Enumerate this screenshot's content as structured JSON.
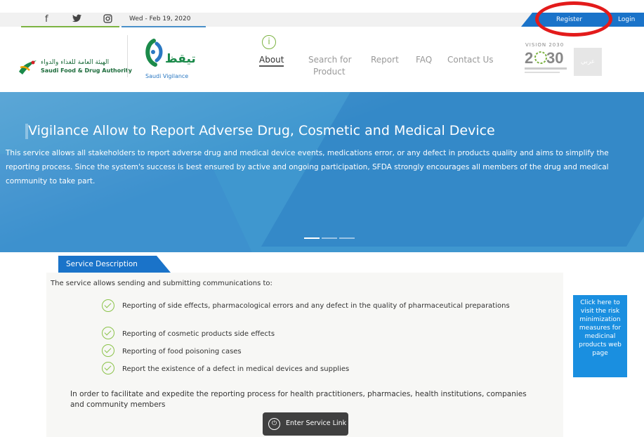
{
  "topbar": {
    "date": "Wed - Feb 19, 2020",
    "register_label": "Register",
    "login_label": "Login"
  },
  "header": {
    "sfda_arabic": "الهيئة العامة للغذاء والدواء",
    "sfda_english": "Saudi Food & Drug Authority",
    "saudi_vigilance_arabic": "تيقظ",
    "saudi_vigilance_label": "Saudi Vigilance",
    "vision_label": "VISION 2030",
    "arabic_button": "عربي"
  },
  "nav": {
    "about": "About",
    "search_line1": "Search for",
    "search_line2": "Product",
    "report": "Report",
    "faq": "FAQ",
    "contact": "Contact Us"
  },
  "hero": {
    "title": "Vigilance Allow to Report Adverse Drug, Cosmetic and Medical Device",
    "description": "This service allows all stakeholders to report adverse drug and medical device events, medications error, or any defect in products quality and aims to simplify the reporting process. Since the system's success is best ensured by active and ongoing participation, SFDA strongly encourages all members of the drug and medical community to take part."
  },
  "service": {
    "tab_label": "Service Description",
    "intro": "The service allows sending and submitting communications to:",
    "items": [
      "Reporting of side effects, pharmacological errors and any defect in the quality of pharmaceutical preparations",
      "Reporting of cosmetic products side effects",
      "Reporting of food poisoning cases",
      "Report the existence of a defect in medical devices and supplies"
    ],
    "footnote": "In order to facilitate and expedite the reporting process for health practitioners, pharmacies, health institutions, companies and community members",
    "enter_button": "Enter Service Link"
  },
  "side_box": {
    "text": "Click here to visit the risk minimization measures for medicinal products web page"
  },
  "colors": {
    "brand_blue": "#1a73c9",
    "hero_blue": "#3f97cf",
    "accent_green": "#7cb342",
    "annotation_red": "#e31b1b"
  }
}
